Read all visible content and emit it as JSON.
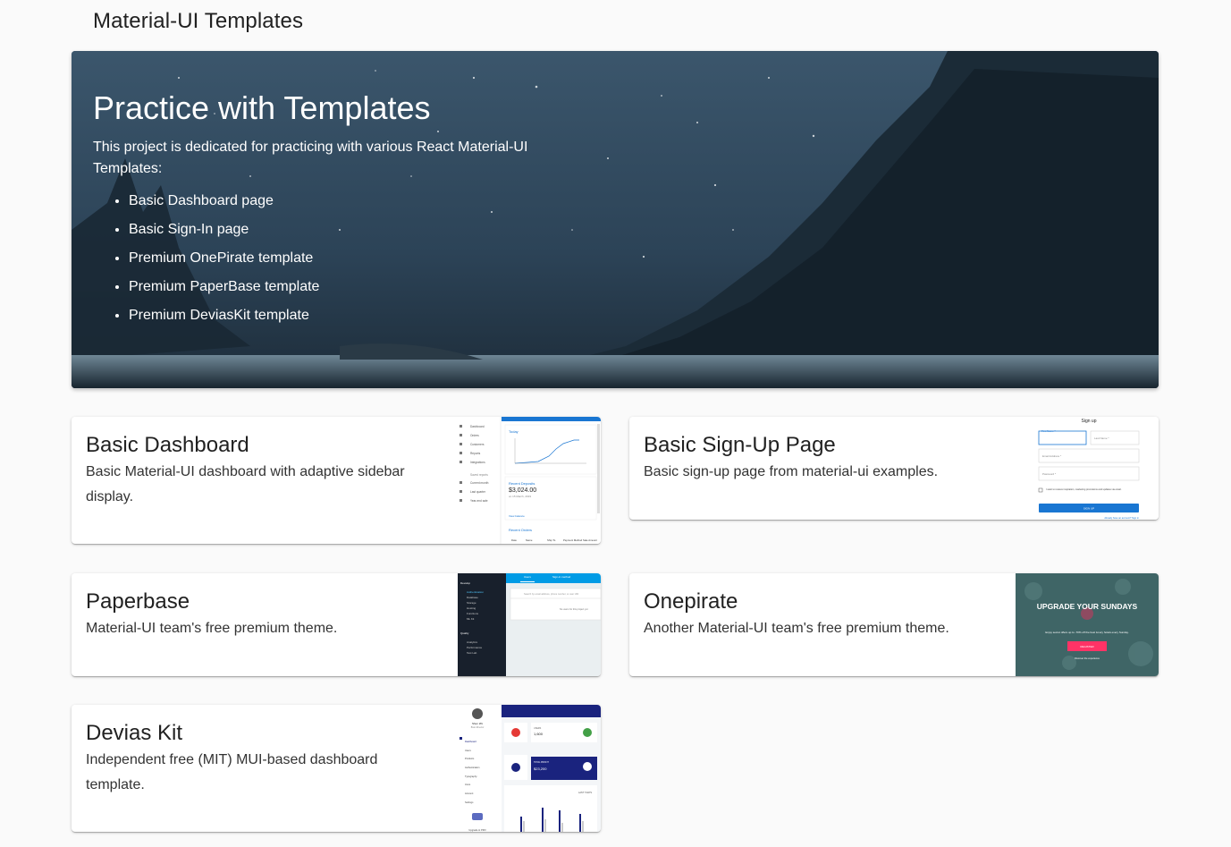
{
  "app": {
    "title": "Material-UI Templates"
  },
  "hero": {
    "title": "Practice with Templates",
    "description": "This project is dedicated for practicing with various React Material-UI Templates:",
    "items": [
      "Basic Dashboard page",
      "Basic Sign-In page",
      "Premium OnePirate template",
      "Premium PaperBase template",
      "Premium DeviasKit template"
    ]
  },
  "cards": [
    {
      "title": "Basic Dashboard",
      "description": "Basic Material-UI dashboard with adaptive sidebar display."
    },
    {
      "title": "Basic Sign-Up Page",
      "description": "Basic sign-up page from material-ui examples."
    },
    {
      "title": "Paperbase",
      "description": "Material-UI team's free premium theme."
    },
    {
      "title": "Onepirate",
      "description": "Another Material-UI team's free premium theme."
    },
    {
      "title": "Devias Kit",
      "description": "Independent free (MIT) MUI-based dashboard template."
    }
  ],
  "thumbnails": {
    "dashboard": {
      "nav": [
        "Dashboard",
        "Orders",
        "Customers",
        "Reports",
        "Integrations"
      ],
      "saved_header": "Saved reports",
      "saved": [
        "Current month",
        "Last quarter",
        "Year-end sale"
      ],
      "today": "Today",
      "deposits_title": "Recent Deposits",
      "deposits_value": "$3,024.00",
      "deposits_date": "on 15 March, 2019",
      "view_balance": "View balance",
      "orders_title": "Recent Orders",
      "order_cols": [
        "Date",
        "Name",
        "Ship To",
        "Payment Method",
        "Sale Amount"
      ]
    },
    "signup": {
      "title": "Sign up",
      "first_name": "First Name *",
      "last_name": "Last Name *",
      "email": "Email Address *",
      "password": "Password *",
      "checkbox": "I want to receive inspiration, marketing promotions and updates via email.",
      "button": "SIGN UP",
      "link": "Already have an account? Sign in"
    },
    "paperbase": {
      "tabs": [
        "Users",
        "Sign-in method"
      ],
      "section1": "Develop",
      "items1": [
        "Authentication",
        "Database",
        "Storage",
        "Hosting",
        "Functions",
        "ML Kit"
      ],
      "section2": "Quality",
      "items2": [
        "Analytics",
        "Performance",
        "Test Lab"
      ],
      "search_placeholder": "Search by email address, phone number, or user UID",
      "empty": "No users for this project yet"
    },
    "onepirate": {
      "headline": "UPGRADE YOUR SUNDAYS",
      "sub": "Enjoy secret offers up to -70% off the best luxury hotels every Sunday.",
      "button": "REGISTER",
      "footer": "Discover the experience"
    },
    "devias": {
      "user": "Shen Zhi",
      "role": "Brain Director",
      "nav": [
        "Dashboard",
        "Users",
        "Products",
        "Authentication",
        "Typography",
        "Icons",
        "Account",
        "Settings"
      ],
      "upgrade": "Upgrade to PRO",
      "stat1_label": "USERS",
      "stat1_value": "1,600",
      "stat2_label": "TOTAL PROFIT",
      "stat2_value": "$23,200",
      "last7": "LAST 7 DAYS"
    }
  },
  "colors": {
    "primary": "#1976d2",
    "onepirate_pink": "#ff3366",
    "paperbase_blue": "#009be5",
    "devias_navy": "#1a237e"
  }
}
